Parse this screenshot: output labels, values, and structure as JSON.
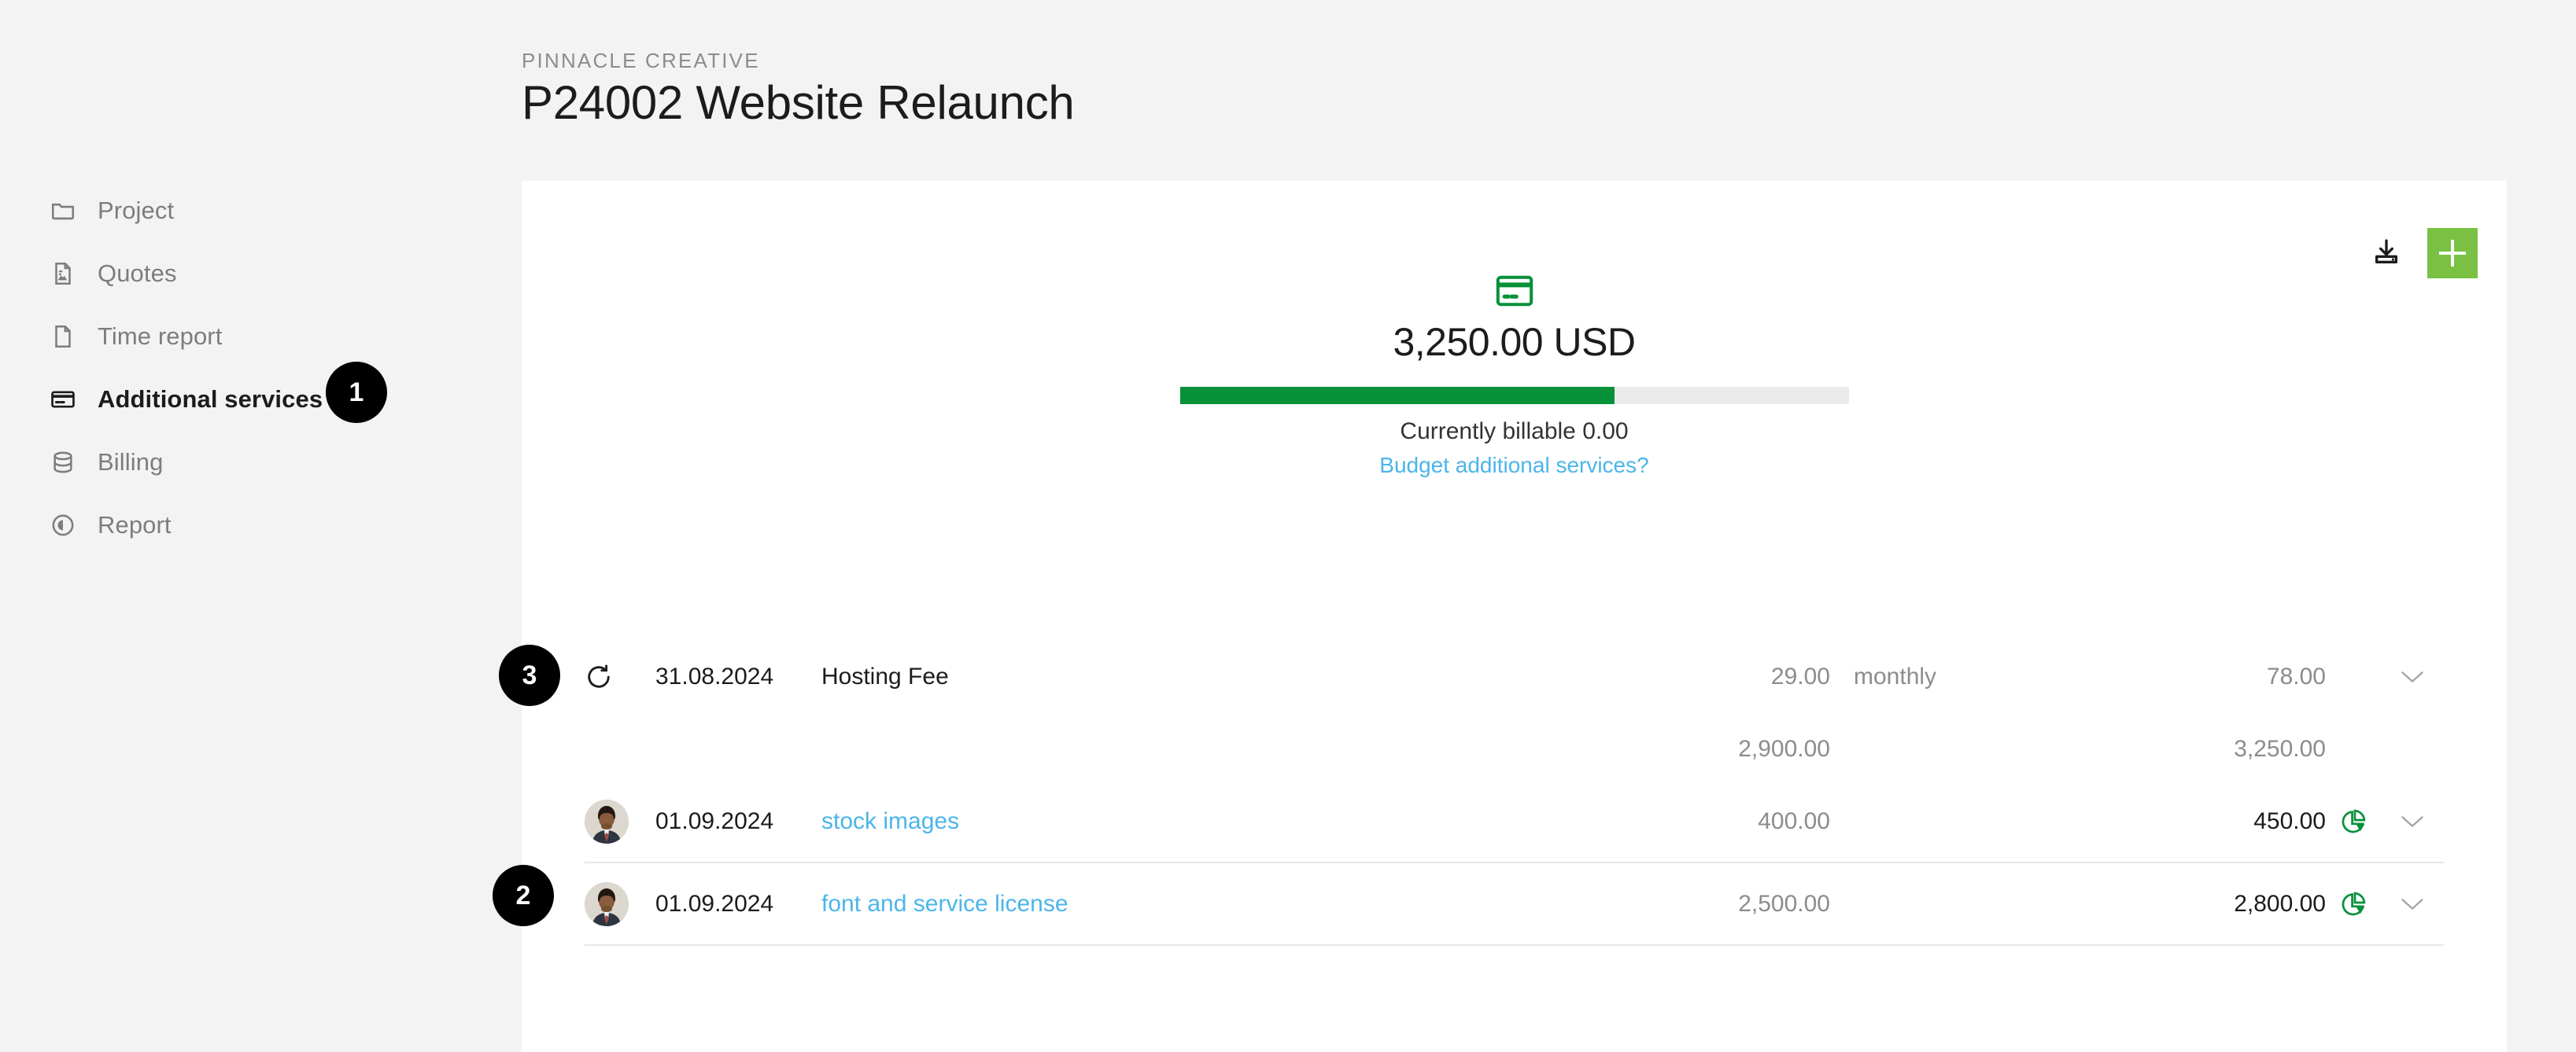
{
  "header": {
    "breadcrumb": "PINNACLE CREATIVE",
    "title": "P24002 Website Relaunch"
  },
  "sidebar": {
    "items": [
      {
        "label": "Project",
        "icon": "folder-icon",
        "active": false
      },
      {
        "label": "Quotes",
        "icon": "quote-doc-icon",
        "active": false
      },
      {
        "label": "Time report",
        "icon": "document-icon",
        "active": false
      },
      {
        "label": "Additional services",
        "icon": "credit-card-icon",
        "active": true
      },
      {
        "label": "Billing",
        "icon": "database-icon",
        "active": false
      },
      {
        "label": "Report",
        "icon": "pie-target-icon",
        "active": false
      }
    ]
  },
  "markers": [
    {
      "id": "1",
      "target": "sidebar-item-additional-services"
    },
    {
      "id": "2",
      "target": "services-table-manual-rows"
    },
    {
      "id": "3",
      "target": "services-table-recurring-row"
    }
  ],
  "toolbar": {
    "download_label": "download-icon",
    "add_label": "+"
  },
  "budget": {
    "icon": "credit-card-icon",
    "amount": "3,250.00 USD",
    "progress_percent": 65,
    "billable_text": "Currently billable 0.00",
    "link_text": "Budget additional services?",
    "bar_color": "#069139",
    "track_color": "#ebebeb"
  },
  "colors": {
    "accent_green": "#7ac143",
    "progress_green": "#069139",
    "link_blue": "#4bb5ea",
    "page_bg": "#f3f3f3",
    "panel_bg": "#ffffff",
    "muted_text": "#8c8c8c"
  },
  "table": {
    "recurring_row": {
      "lead_icon": "refresh-recurring-icon",
      "date": "31.08.2024",
      "name": "Hosting Fee",
      "amount": "29.00",
      "unit": "monthly",
      "total": "78.00",
      "chevron": "chevron-down-icon"
    },
    "subtotal_row": {
      "amount": "2,900.00",
      "total": "3,250.00"
    },
    "rows": [
      {
        "avatar": "user-avatar",
        "date": "01.09.2024",
        "name": "stock images",
        "amount": "400.00",
        "unit": "",
        "total": "450.00",
        "pie": "pie-chart-icon",
        "chevron": "chevron-down-icon"
      },
      {
        "avatar": "user-avatar",
        "date": "01.09.2024",
        "name": "font and service license",
        "amount": "2,500.00",
        "unit": "",
        "total": "2,800.00",
        "pie": "pie-chart-icon",
        "chevron": "chevron-down-icon"
      }
    ]
  }
}
